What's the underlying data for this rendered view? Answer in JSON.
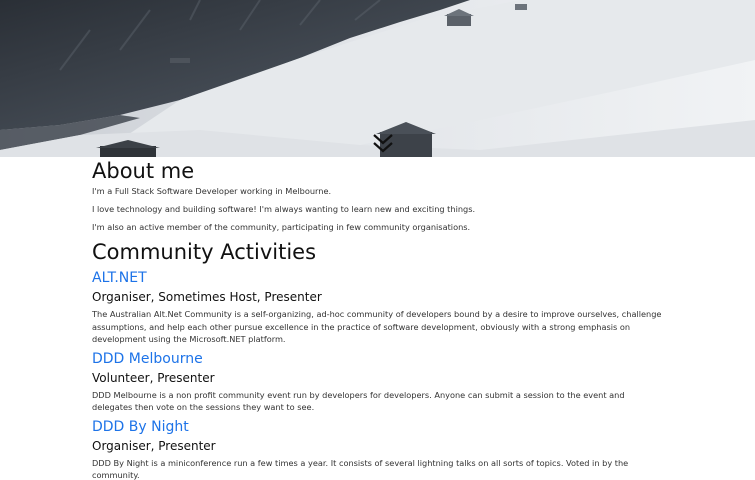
{
  "hero": {
    "scroll_icon": "double-chevron-down-icon"
  },
  "about": {
    "heading": "About me",
    "paragraphs": [
      "I'm a Full Stack Software Developer working in Melbourne.",
      "I love technology and building software! I'm always wanting to learn new and exciting things.",
      "I'm also an active member of the community, participating in few community organisations."
    ]
  },
  "community": {
    "heading": "Community Activities",
    "activities": [
      {
        "name": "ALT.NET",
        "role": "Organiser, Sometimes Host, Presenter",
        "description": "The Australian Alt.Net Community is a self-organizing, ad-hoc community of developers bound by a desire to improve ourselves, challenge assumptions, and help each other pursue excellence in the practice of software development, obviously with a strong emphasis on development using the Microsoft.NET platform."
      },
      {
        "name": "DDD Melbourne",
        "role": "Volunteer, Presenter",
        "description": "DDD Melbourne is a non profit community event run by developers for developers. Anyone can submit a session to the event and delegates then vote on the sessions they want to see."
      },
      {
        "name": "DDD By Night",
        "role": "Organiser, Presenter",
        "description": "DDD By Night is a miniconference run a few times a year. It consists of several lightning talks on all sorts of topics. Voted in by the community."
      }
    ]
  },
  "colors": {
    "link": "#1d73e8",
    "text": "#212529"
  }
}
